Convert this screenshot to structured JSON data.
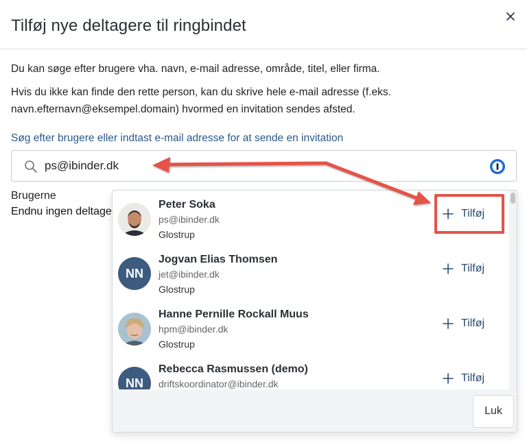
{
  "dialog": {
    "title": "Tilføj nye deltagere til ringbindet",
    "intro": "Du kan søge efter brugere vha. navn, e-mail adresse, område, titel, eller firma.",
    "invite_hint": "Hvis du ikke kan finde den rette person, kan du skrive hele e-mail adresse (f.eks. navn.efternavn@eksempel.domain) hvormed en invitation sendes afsted."
  },
  "search": {
    "label": "Søg efter brugere eller indtast e-mail adresse for at sende en invitation",
    "value": "ps@ibinder.dk"
  },
  "users": {
    "heading": "Brugerne",
    "empty": "Endnu ingen deltagere"
  },
  "results": [
    {
      "name": "Peter Soka",
      "email": "ps@ibinder.dk",
      "city": "Glostrup",
      "avatar": "photo",
      "add_label": "Tilføj"
    },
    {
      "name": "Jogvan Elias Thomsen",
      "email": "jet@ibinder.dk",
      "city": "Glostrup",
      "avatar": "NN",
      "add_label": "Tilføj"
    },
    {
      "name": "Hanne Pernille Rockall Muus",
      "email": "hpm@ibinder.dk",
      "city": "Glostrup",
      "avatar": "photo",
      "add_label": "Tilføj"
    },
    {
      "name": "Rebecca Rasmussen (demo)",
      "email": "driftskoordinator@ibinder.dk",
      "city": "",
      "avatar": "NN",
      "add_label": "Tilføj"
    }
  ],
  "footer": {
    "close_label": "Luk"
  },
  "colors": {
    "accent": "#2a5a8a",
    "annotation": "#e5524a",
    "avatar_initials_bg": "#3c5b7f"
  },
  "icons": {
    "close": "close-icon",
    "search": "search-icon",
    "password_manager": "password-manager-icon",
    "add": "plus-icon"
  }
}
